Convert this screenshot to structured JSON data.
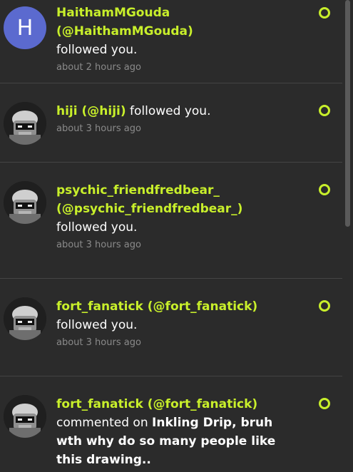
{
  "notifications": [
    {
      "avatar_letter": "H",
      "name": "HaithamMGouda (@HaithamMGouda)",
      "action": "followed you.",
      "time": "about 2 hours ago"
    },
    {
      "name": "hiji (@hiji)",
      "action": "followed you.",
      "time": "about 3 hours ago"
    },
    {
      "name": "psychic_friendfredbear_ (@psychic_friendfredbear_)",
      "action": "followed you.",
      "time": "about 3 hours ago"
    },
    {
      "name": "fort_fanatick (@fort_fanatick)",
      "action": "followed you.",
      "time": "about 3 hours ago"
    },
    {
      "name": "fort_fanatick (@fort_fanatick)",
      "action": "commented on",
      "target": "Inkling Drip, bruh wth why do so many people like this drawing.."
    }
  ],
  "icons": {
    "unread": "unread-dot-icon",
    "avatar_default": "robot-avatar-icon"
  },
  "colors": {
    "background": "#2b2b2b",
    "accent": "#c8ef2b",
    "avatar_letter_bg": "#5b6acf",
    "muted_text": "#8a8a8a"
  }
}
